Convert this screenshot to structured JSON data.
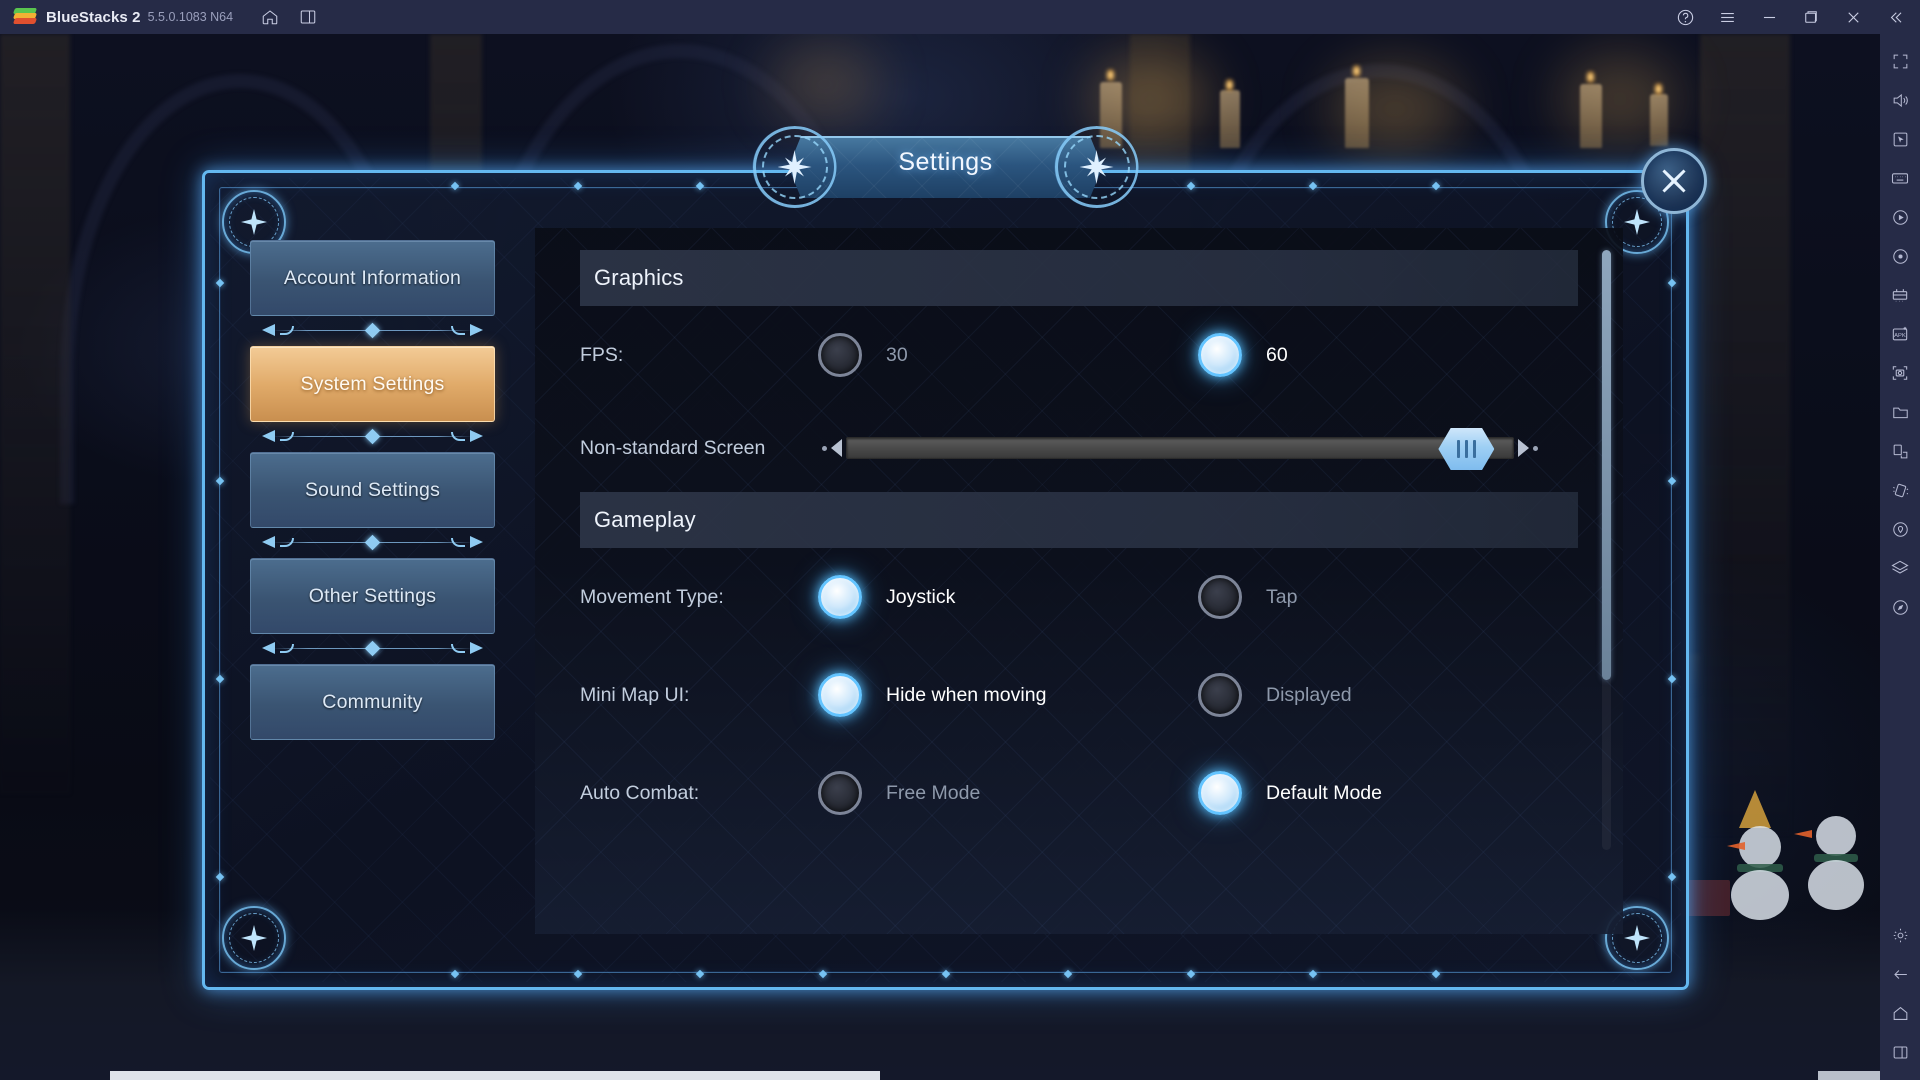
{
  "titlebar": {
    "app_name": "BlueStacks 2",
    "version": "5.5.0.1083 N64",
    "left_icons": [
      {
        "name": "home-icon",
        "label": "Home"
      },
      {
        "name": "instance-manager-icon",
        "label": "Instance Manager"
      }
    ],
    "right_icons": [
      {
        "name": "help-icon",
        "label": "Help"
      },
      {
        "name": "menu-icon",
        "label": "Menu"
      },
      {
        "name": "minimize-icon",
        "label": "Minimize"
      },
      {
        "name": "maximize-icon",
        "label": "Maximize"
      },
      {
        "name": "close-icon",
        "label": "Close"
      },
      {
        "name": "collapse-sidebar-icon",
        "label": "Collapse"
      }
    ]
  },
  "rail": {
    "icons": [
      {
        "name": "fullscreen-icon",
        "label": "Fullscreen"
      },
      {
        "name": "volume-icon",
        "label": "Volume"
      },
      {
        "name": "pointer-icon",
        "label": "Pointer"
      },
      {
        "name": "keyboard-controls-icon",
        "label": "Game controls"
      },
      {
        "name": "macro-recorder-icon",
        "label": "Macro recorder"
      },
      {
        "name": "screen-record-icon",
        "label": "Record screen"
      },
      {
        "name": "multi-instance-icon",
        "label": "Multi-instance"
      },
      {
        "name": "install-apk-icon",
        "label": "Install APK"
      },
      {
        "name": "screenshot-icon",
        "label": "Screenshot"
      },
      {
        "name": "media-folder-icon",
        "label": "Media manager"
      },
      {
        "name": "rotate-icon",
        "label": "Rotate"
      },
      {
        "name": "shake-icon",
        "label": "Shake"
      },
      {
        "name": "location-icon",
        "label": "Location"
      },
      {
        "name": "layers-icon",
        "label": "Eco mode"
      },
      {
        "name": "compass-icon",
        "label": "Compass"
      }
    ],
    "bottom_icons": [
      {
        "name": "settings-gear-icon",
        "label": "Settings"
      },
      {
        "name": "back-arrow-icon",
        "label": "Back"
      },
      {
        "name": "android-home-icon",
        "label": "Home"
      },
      {
        "name": "recent-apps-icon",
        "label": "Recent apps"
      }
    ]
  },
  "modal": {
    "title": "Settings",
    "close_label": "Close",
    "sidebar": {
      "items": [
        {
          "label": "Account Information",
          "active": false
        },
        {
          "label": "System Settings",
          "active": true
        },
        {
          "label": "Sound Settings",
          "active": false
        },
        {
          "label": "Other Settings",
          "active": false
        },
        {
          "label": "Community",
          "active": false
        }
      ]
    },
    "sections": [
      {
        "title": "Graphics",
        "rows": [
          {
            "type": "radio",
            "label": "FPS:",
            "options": [
              {
                "label": "30",
                "selected": false
              },
              {
                "label": "60",
                "selected": true
              }
            ]
          },
          {
            "type": "slider",
            "label": "Non-standard Screen",
            "value_percent": 93
          }
        ]
      },
      {
        "title": "Gameplay",
        "rows": [
          {
            "type": "radio",
            "label": "Movement Type:",
            "options": [
              {
                "label": "Joystick",
                "selected": true
              },
              {
                "label": "Tap",
                "selected": false
              }
            ]
          },
          {
            "type": "radio",
            "label": "Mini Map UI:",
            "options": [
              {
                "label": "Hide when moving",
                "selected": true
              },
              {
                "label": "Displayed",
                "selected": false
              }
            ]
          },
          {
            "type": "radio",
            "label": "Auto Combat:",
            "options": [
              {
                "label": "Free Mode",
                "selected": false
              },
              {
                "label": "Default Mode",
                "selected": true
              }
            ]
          }
        ]
      }
    ]
  },
  "colors": {
    "accent_blue": "#63c4ff",
    "active_nav_gold": "#e0aa69",
    "panel_dark": "#0c101c",
    "titlebar": "#262b47"
  }
}
